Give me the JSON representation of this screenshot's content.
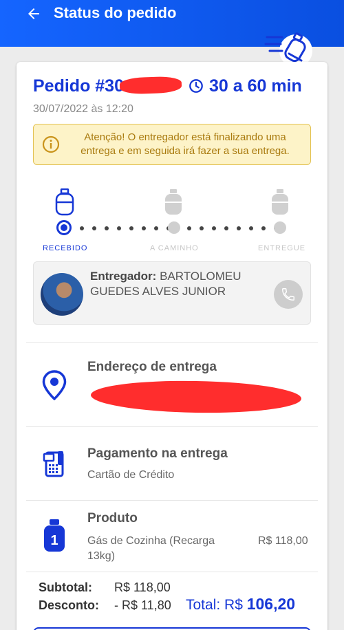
{
  "header": {
    "title": "Status do pedido",
    "back_icon": "arrow-left-icon",
    "decoration_icon": "gas-delivery-icon",
    "color": "#1565ff"
  },
  "order": {
    "title": "Pedido #30",
    "eta": "30 a 60 min",
    "date": "30/07/2022 às 12:20",
    "accent": "#1637d6"
  },
  "alert": {
    "text": "Atenção! O entregador está finalizando uma entrega e em seguida irá fazer a sua entrega."
  },
  "steps": [
    {
      "label": "RECEBIDO",
      "active": true
    },
    {
      "label": "A CAMINHO",
      "active": false
    },
    {
      "label": "ENTREGUE",
      "active": false
    }
  ],
  "driver": {
    "label": "Entregador:",
    "name": "BARTOLOMEU GUEDES ALVES JUNIOR"
  },
  "address": {
    "title": "Endereço de entrega"
  },
  "payment": {
    "title": "Pagamento na entrega",
    "method": "Cartão de Crédito"
  },
  "product": {
    "title": "Produto",
    "name": "Gás de Cozinha (Recarga 13kg)",
    "price": "R$ 118,00",
    "quantity": "1"
  },
  "totals": {
    "subtotal_label": "Subtotal:",
    "subtotal_value": "R$ 118,00",
    "discount_label": "Desconto:",
    "discount_value": "- R$ 11,80",
    "total_label": "Total: R$",
    "total_value": "106,20"
  }
}
